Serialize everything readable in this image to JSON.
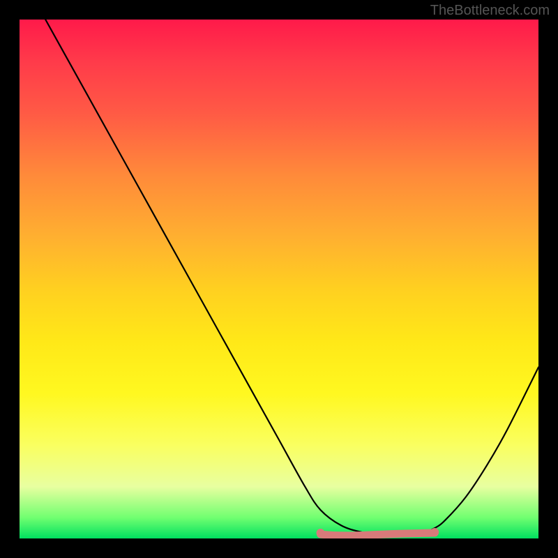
{
  "watermark": "TheBottleneck.com",
  "chart_data": {
    "type": "line",
    "title": "",
    "xlabel": "",
    "ylabel": "",
    "xlim": [
      0,
      100
    ],
    "ylim": [
      0,
      100
    ],
    "grid": false,
    "series": [
      {
        "name": "curve",
        "x": [
          5,
          10,
          15,
          20,
          25,
          30,
          35,
          40,
          45,
          50,
          55,
          58,
          62,
          66,
          70,
          74,
          78,
          80,
          82,
          86,
          90,
          94,
          100
        ],
        "y": [
          100,
          91,
          82,
          73,
          64,
          55,
          46,
          37,
          28,
          19,
          10,
          5.5,
          2.5,
          1.2,
          0.6,
          0.6,
          1.2,
          2.0,
          3.5,
          8,
          14,
          21,
          33
        ],
        "color": "#000000"
      }
    ],
    "highlight": {
      "x_range": [
        58,
        80
      ],
      "y": 0.8,
      "color": "#d87a7a"
    },
    "background_gradient": {
      "top": "#ff1a4a",
      "bottom": "#00e060"
    }
  }
}
